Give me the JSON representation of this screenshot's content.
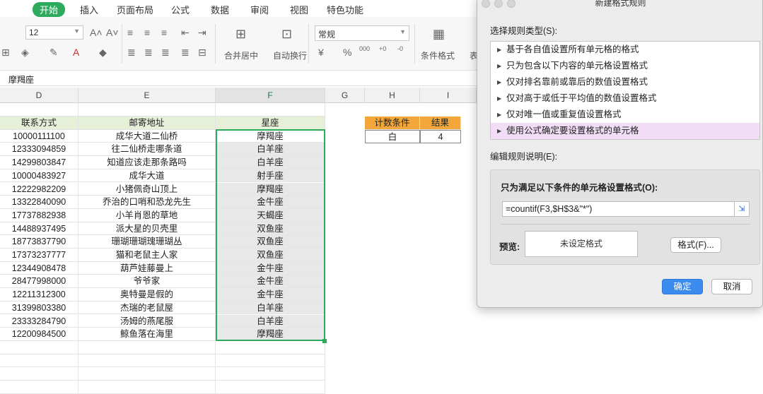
{
  "ribbon": {
    "tabs": [
      "开始",
      "插入",
      "页面布局",
      "公式",
      "数据",
      "审阅",
      "视图",
      "特色功能"
    ],
    "font_size": "12",
    "number_format": "常规",
    "merge_label": "合并居中",
    "wrap_label": "自动换行",
    "cond_format_label": "条件格式",
    "table_label": "表"
  },
  "name_box": "摩羯座",
  "columns": [
    "D",
    "E",
    "F",
    "G",
    "H",
    "I"
  ],
  "table": {
    "headers": [
      "联系方式",
      "邮寄地址",
      "星座"
    ],
    "rows": [
      [
        "10000111100",
        "成华大道二仙桥",
        "摩羯座"
      ],
      [
        "12333094859",
        "往二仙桥走哪条道",
        "白羊座"
      ],
      [
        "14299803847",
        "知道应该走那条路吗",
        "白羊座"
      ],
      [
        "10000483927",
        "成华大道",
        "射手座"
      ],
      [
        "12222982209",
        "小猪佩奇山顶上",
        "摩羯座"
      ],
      [
        "13322840090",
        "乔治的口哨和恐龙先生",
        "金牛座"
      ],
      [
        "17737882938",
        "小羊肖恩的草地",
        "天蝎座"
      ],
      [
        "14488937495",
        "派大星的贝壳里",
        "双鱼座"
      ],
      [
        "18773837790",
        "珊瑚珊瑚瑰珊瑚丛",
        "双鱼座"
      ],
      [
        "17373237777",
        "猫和老鼠主人家",
        "双鱼座"
      ],
      [
        "12344908478",
        "葫芦娃藤曼上",
        "金牛座"
      ],
      [
        "28477998000",
        "爷爷家",
        "金牛座"
      ],
      [
        "12211312300",
        "奥特曼是假的",
        "金牛座"
      ],
      [
        "31399803380",
        "杰瑞的老鼠屋",
        "白羊座"
      ],
      [
        "23333284790",
        "汤姆的燕尾服",
        "白羊座"
      ],
      [
        "12200984500",
        "鲸鱼落在海里",
        "摩羯座"
      ]
    ]
  },
  "count_table": {
    "headers": [
      "计数条件",
      "结果"
    ],
    "values": [
      "白",
      "4"
    ]
  },
  "dialog": {
    "title": "新建格式规则",
    "rule_type_label": "选择规则类型(S):",
    "rule_types": [
      "基于各自值设置所有单元格的格式",
      "只为包含以下内容的单元格设置格式",
      "仅对排名靠前或靠后的数值设置格式",
      "仅对高于或低于平均值的数值设置格式",
      "仅对唯一值或重复值设置格式",
      "使用公式确定要设置格式的单元格"
    ],
    "edit_label": "编辑规则说明(E):",
    "condition_label": "只为满足以下条件的单元格设置格式(O):",
    "formula": "=countif(F3,$H$3&\"*\")",
    "preview_label": "预览:",
    "preview_text": "未设定格式",
    "format_button": "格式(F)...",
    "ok_button": "确定",
    "cancel_button": "取消"
  },
  "colors": {
    "accent": "#2eaa5c",
    "header_fill": "#e6f0d8",
    "orange": "#f3a73a",
    "selected_rule": "#f1ddf6",
    "ok": "#3c8cf0"
  }
}
